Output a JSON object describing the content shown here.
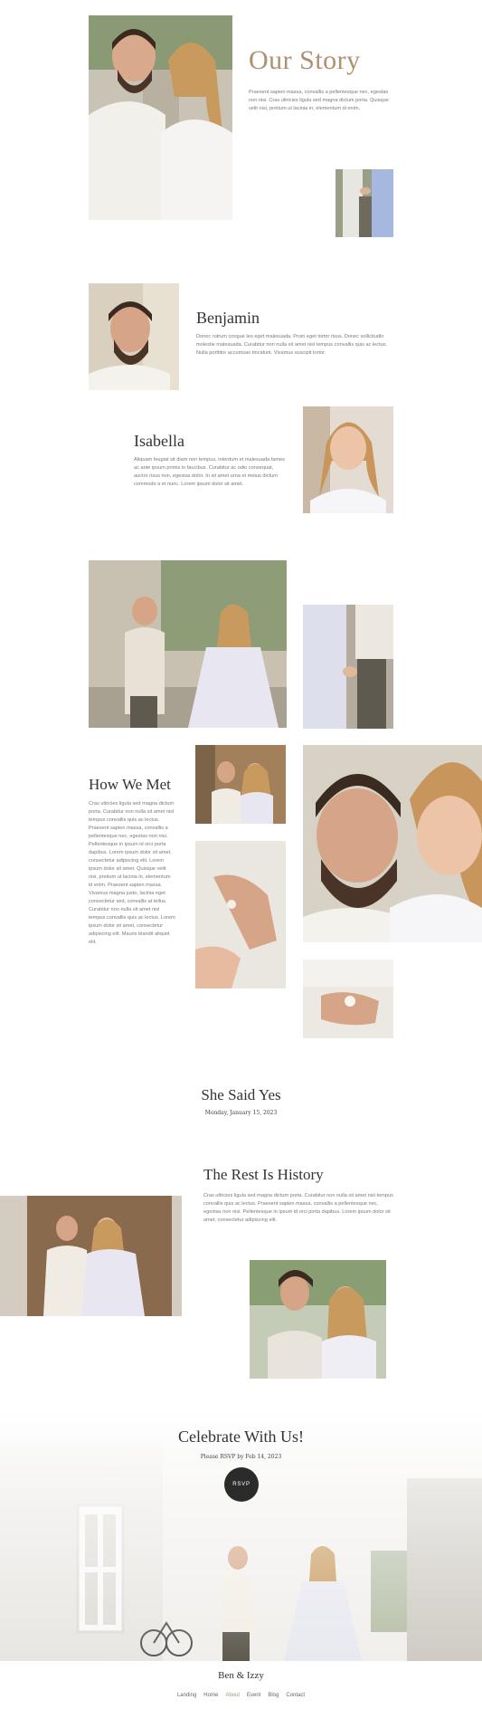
{
  "our_story": {
    "title": "Our Story",
    "text": "Praesent sapien massa, convallis a pellentesque nec, egestas non nisi. Cras ultricies ligula sed magna dictum porta. Quisque velit nisi, pretium ut lacinia in, elementum id enim."
  },
  "benjamin": {
    "name": "Benjamin",
    "text": "Donec rutrum congue leo eget malesuada. Proin eget tortor risus. Donec sollicitudin molestie malesuada. Curabitur non nulla sit amet nisl tempus convallis quis ac lectus. Nulla porttitor accumsan tincidunt. Vivamus suscipit tortor."
  },
  "isabella": {
    "name": "Isabella",
    "text": "Aliquam feugiat sit diam non tempus, interdum et malesuada fames ac ante ipsum primis in faucibus. Curabitur ac odio consequat, auctor risus non, egestas dolor. In sit amet urna et metus dictum commodo a et nunc. Lorem ipsum dolor sit amet."
  },
  "how_we_met": {
    "title": "How We Met",
    "paragraph1": "Cras ultricies ligula sed magna dictum porta. Curabitur non nulla sit amet nisl tempus convallis quis ac lectus. Praesent sapien massa, convallis a pellentesque nec, egestas non nisi. Pellentesque in ipsum id orci porta dapibus. Lorem ipsum dolor sit amet, consectetur adipiscing elit. Lorem ipsum dolor sit amet. Quisque velit nisi, pretium ut lacinia in, elementum id enim. Praesent sapien massa.",
    "paragraph2": "Vivamus magna justo, lacinia eget consectetur sed, convallis at tellus. Curabitur non nulla sit amet nisl tempus convallis quis ac lectus. Lorem ipsum dolor sit amet, consectetur adipiscing elit. Mauris blandit aliquet elit."
  },
  "she_said_yes": {
    "title": "She Said Yes",
    "date": "Monday, January 15, 2023"
  },
  "rest_is_history": {
    "title": "The Rest Is History",
    "text": "Cras ultricies ligula sed magna dictum porta. Curabitur non nulla sit amet nisl tempus convallis quis ac lectus. Praesent sapien massa, convallis a pellentesque nec, egestas non nisi. Pellentesque in ipsum id orci porta dapibus. Lorem ipsum dolor sit amet, consectetur adipiscing elit."
  },
  "celebrate": {
    "title": "Celebrate With Us!",
    "subtitle": "Please RSVP by Feb 14, 2023",
    "button_label": "RSVP"
  },
  "footer": {
    "brand": "Ben & Izzy",
    "nav": [
      "Landing",
      "Home",
      "About",
      "Event",
      "Blog",
      "Contact"
    ],
    "active_index": 2
  },
  "colors": {
    "accent": "#b09070",
    "heading": "#333333",
    "body": "#7a7a7a",
    "button_bg": "#2b2b2b"
  }
}
